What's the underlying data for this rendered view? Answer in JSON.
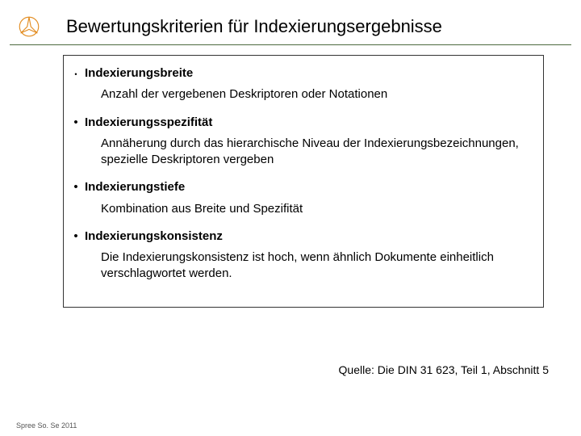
{
  "title": "Bewertungskriterien für Indexierungsergebnisse",
  "items": [
    {
      "head": "Indexierungsbreite",
      "desc": "Anzahl der vergebenen Deskriptoren oder Notationen"
    },
    {
      "head": "Indexierungsspezifität",
      "desc": "Annäherung durch das hierarchische Niveau der Indexierungsbezeichnungen, spezielle Deskriptoren vergeben"
    },
    {
      "head": "Indexierungstiefe",
      "desc": "Kombination aus Breite und Spezifität"
    },
    {
      "head": "Indexierungskonsistenz",
      "desc": "Die Indexierungskonsistenz ist hoch, wenn ähnlich Dokumente einheitlich verschlagwortet werden."
    }
  ],
  "source": "Quelle: Die DIN 31 623, Teil 1, Abschnitt 5",
  "footer": "Spree So. Se 2011",
  "colors": {
    "accent_green": "#4d6a3f",
    "star_orange": "#e28b1e"
  }
}
